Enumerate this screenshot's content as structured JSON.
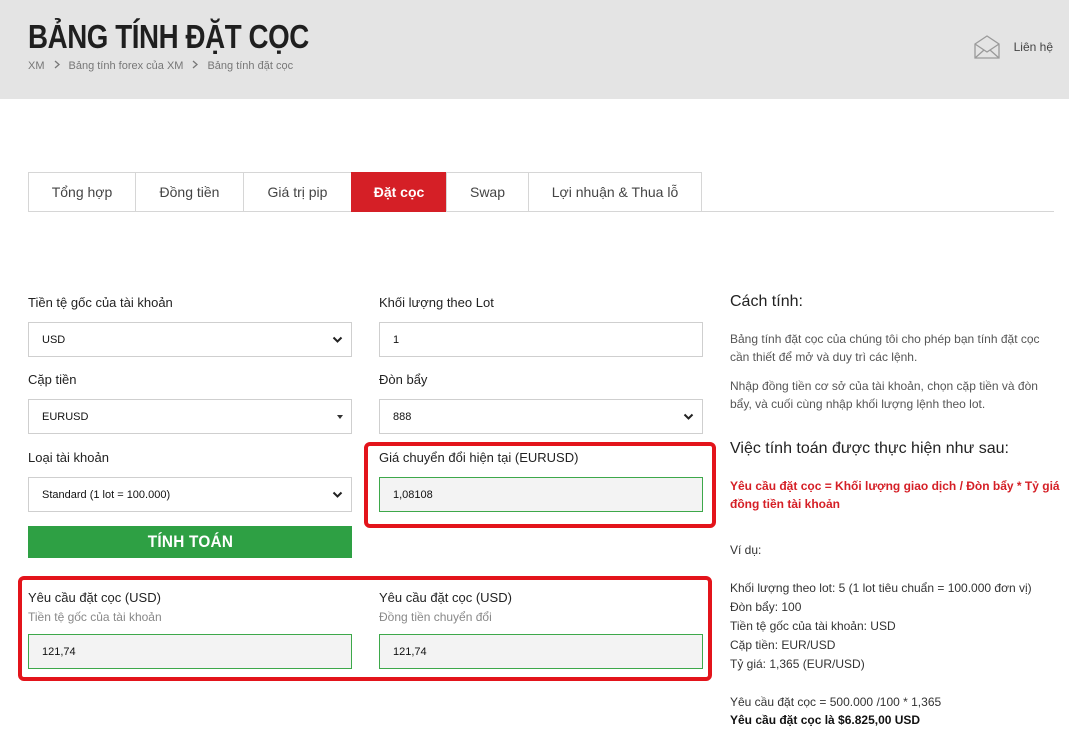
{
  "header": {
    "title": "BẢNG TÍNH ĐẶT CỌC",
    "breadcrumb": [
      "XM",
      "Bảng tính forex của XM",
      "Bảng tính đặt cọc"
    ],
    "contact_label": "Liên hệ"
  },
  "tabs": [
    {
      "label": "Tổng hợp",
      "active": false
    },
    {
      "label": "Đồng tiền",
      "active": false
    },
    {
      "label": "Giá trị pip",
      "active": false
    },
    {
      "label": "Đặt cọc",
      "active": true
    },
    {
      "label": "Swap",
      "active": false
    },
    {
      "label": "Lợi nhuận & Thua lỗ",
      "active": false
    }
  ],
  "form": {
    "base_currency": {
      "label": "Tiền tệ gốc của tài khoản",
      "value": "USD"
    },
    "lot_volume": {
      "label": "Khối lượng theo Lot",
      "value": "1"
    },
    "currency_pair": {
      "label": "Cặp tiền",
      "value": "EURUSD"
    },
    "leverage": {
      "label": "Đòn bẩy",
      "value": "888"
    },
    "account_type": {
      "label": "Loại tài khoản",
      "value": "Standard (1 lot = 100.000)"
    },
    "conversion_rate": {
      "label": "Giá chuyển đổi hiện tại (EURUSD)",
      "value": "1,08108"
    },
    "calculate_label": "TÍNH TOÁN"
  },
  "results": {
    "margin_base": {
      "label": "Yêu cầu đặt cọc (USD)",
      "sub": "Tiền tệ gốc của tài khoản",
      "value": "121,74"
    },
    "margin_converted": {
      "label": "Yêu cầu đặt cọc (USD)",
      "sub": "Đồng tiền chuyển đổi",
      "value": "121,74"
    }
  },
  "sidebar": {
    "how_title": "Cách tính:",
    "how_p1": "Bảng tính đặt cọc của chúng tôi cho phép bạn tính đặt cọc cần thiết để mở và duy trì các lệnh.",
    "how_p2": "Nhập đồng tiền cơ sở của tài khoản, chọn cặp tiền và đòn bẩy, và cuối cùng nhập khối lượng lệnh theo lot.",
    "calc_title": "Việc tính toán được thực hiện như sau:",
    "formula": "Yêu cầu đặt cọc = Khối lượng giao dịch / Đòn bẩy * Tỷ giá đồng tiền tài khoản",
    "example_label": "Ví dụ:",
    "example_lines": [
      "Khối lượng theo lot: 5 (1 lot tiêu chuẩn = 100.000 đơn vị)",
      "Đòn bẩy: 100",
      "Tiền tệ gốc của tài khoản: USD",
      "Cặp tiền: EUR/USD",
      "Tỷ giá: 1,365 (EUR/USD)"
    ],
    "result_line": "Yêu cầu đặt cọc = 500.000 /100 * 1,365",
    "result_bold": "Yêu cầu đặt cọc là $6.825,00 USD"
  },
  "colors": {
    "brand_red": "#d51f26",
    "button_green": "#2ea044",
    "highlight_red": "#e3141b"
  }
}
